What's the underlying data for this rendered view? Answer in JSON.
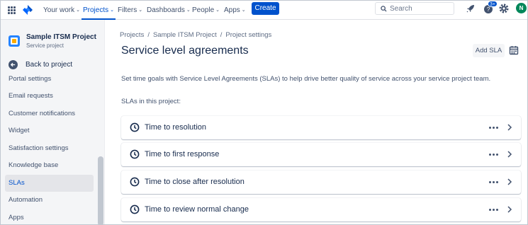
{
  "topnav": {
    "items": [
      {
        "label": "Your work"
      },
      {
        "label": "Projects"
      },
      {
        "label": "Filters"
      },
      {
        "label": "Dashboards"
      },
      {
        "label": "People"
      },
      {
        "label": "Apps"
      }
    ],
    "active_item": "Projects",
    "create_label": "Create",
    "search_placeholder": "Search",
    "notifications_badge": "3+",
    "avatar_initial": "N",
    "accent_color": "#0052cc",
    "icons": [
      "app-switcher-icon",
      "jira-logo-icon",
      "search-icon",
      "rocket-icon",
      "help-icon",
      "settings-icon"
    ]
  },
  "sidebar": {
    "project_name": "Sample ITSM Project",
    "project_type": "Service project",
    "back_label": "Back to project",
    "items": [
      {
        "label": "Portal settings"
      },
      {
        "label": "Email requests"
      },
      {
        "label": "Customer notifications"
      },
      {
        "label": "Widget"
      },
      {
        "label": "Satisfaction settings"
      },
      {
        "label": "Knowledge base"
      },
      {
        "label": "SLAs"
      },
      {
        "label": "Automation"
      },
      {
        "label": "Apps"
      }
    ],
    "selected_item": "SLAs"
  },
  "main": {
    "breadcrumb": [
      "Projects",
      "Sample ITSM Project",
      "Project settings"
    ],
    "title": "Service level agreements",
    "add_button": "Add SLA",
    "description": "Set time goals with Service Level Agreements (SLAs) to help drive better quality of service across your service project team.",
    "list_label": "SLAs in this project:",
    "slas": [
      {
        "name": "Time to resolution"
      },
      {
        "name": "Time to first response"
      },
      {
        "name": "Time to close after resolution"
      },
      {
        "name": "Time to review normal change"
      }
    ]
  }
}
